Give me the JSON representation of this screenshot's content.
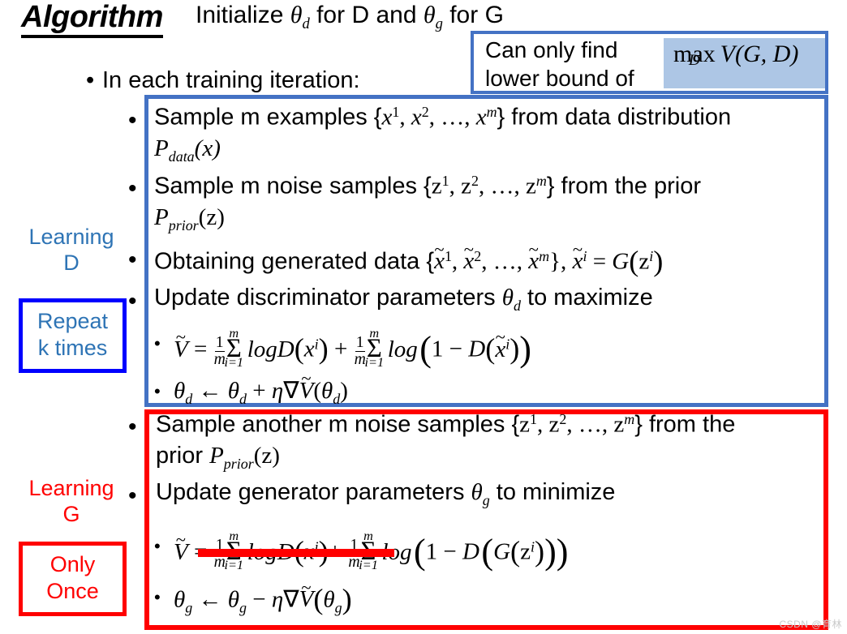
{
  "slide": {
    "title": "Algorithm",
    "watermark": "CSDN @育林"
  },
  "init": {
    "prefix": "Initialize ",
    "theta1": "θ",
    "sub1": "d",
    "mid": " for D and ",
    "theta2": "θ",
    "sub2": "g",
    "suffix": " for G"
  },
  "iteration": {
    "bullet": "•",
    "text": "In each training iteration:"
  },
  "callout": {
    "line1": "Can only find",
    "line2": "lower bound of",
    "formula": {
      "max": "max",
      "limit": "D",
      "expr": "V(G, D)"
    },
    "border_color": "#4472C4",
    "formula_bg": "#ADC6E5"
  },
  "sidebar": {
    "learning_d": "Learning D",
    "learning_d_color": "#2E74B5",
    "repeat_box": "Repeat k times",
    "repeat_box_border": "#0000FF",
    "learning_g": "Learning G",
    "learning_g_color": "#FF0000",
    "only_once_box": "Only Once",
    "only_once_box_border": "#FF0000"
  },
  "learning_d_box": {
    "border_color": "#4472C4",
    "steps": [
      {
        "bullet": "•",
        "text_a": "Sample m examples {",
        "set": "x¹, x², …, x",
        "text_b": "} from data distribution",
        "text_c": "P",
        "sub": "data",
        "arg": "(x)"
      },
      {
        "bullet": "•",
        "text_a": "Sample m noise samples {",
        "set": "z¹, z², …, z",
        "text_b": "} from the prior",
        "text_c": "P",
        "sub": "prior",
        "arg": "(z)"
      },
      {
        "bullet": "•",
        "text_a": "Obtaining generated data {x̃¹, x̃², …, x̃ᵐ}, x̃ⁱ = G(zⁱ)"
      },
      {
        "bullet": "•",
        "text_a": "Update discriminator parameters θ",
        "sub": "d",
        "text_b": " to maximize"
      }
    ],
    "formulas": [
      {
        "bullet": "•",
        "latex": "Ṽ = (1/m)Σ_{i=1}^{m} logD(xⁱ) + (1/m)Σ_{i=1}^{m} log(1 − D(x̃ⁱ))"
      },
      {
        "bullet": "•",
        "latex": "θ_d ← θ_d + η∇Ṽ(θ_d)"
      }
    ]
  },
  "learning_g_box": {
    "border_color": "#FF0000",
    "steps": [
      {
        "bullet": "•",
        "line1": "Sample another m noise samples {z¹, z², …, zᵐ} from the",
        "line2_a": "prior P",
        "line2_sub": "prior",
        "line2_b": "(z)"
      },
      {
        "bullet": "•",
        "text_a": "Update generator parameters θ",
        "sub": "g",
        "text_b": " to minimize"
      }
    ],
    "formulas": [
      {
        "bullet": "•",
        "latex": "Ṽ = (1/m)Σ_{i=1}^{m} logD(xⁱ) + (1/m)Σ_{i=1}^{m} log(1 − D(G(zⁱ)))",
        "struck_term": "(1/m)Σ_{i=1}^{m} logD(xⁱ)",
        "strike_color": "#FF0000"
      },
      {
        "bullet": "•",
        "latex": "θ_g ← θ_g − η∇Ṽ(θ_g)"
      }
    ]
  }
}
